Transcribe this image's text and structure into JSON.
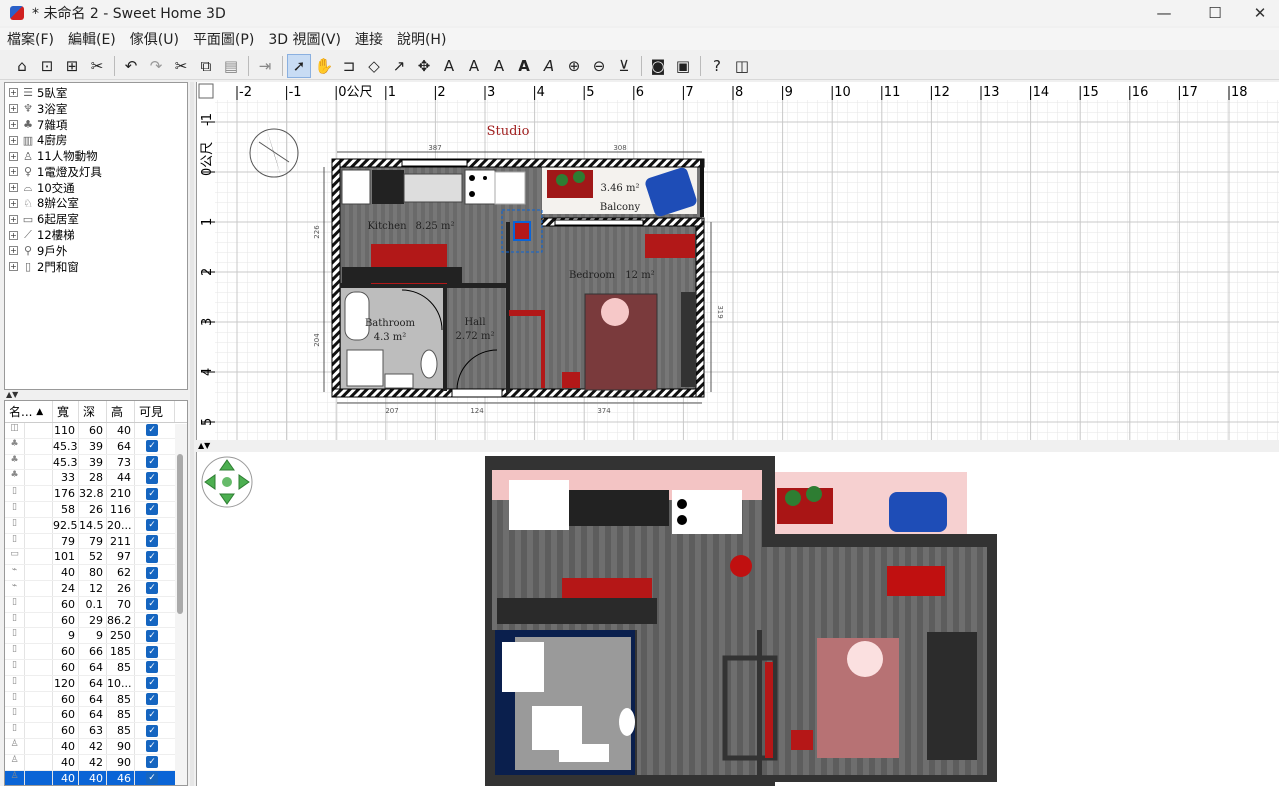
{
  "window": {
    "title": "* 未命名 2 - Sweet Home 3D",
    "min": "—",
    "max": "☐",
    "close": "✕"
  },
  "menu": [
    "檔案(F)",
    "編輯(E)",
    "傢俱(U)",
    "平面圖(P)",
    "3D 視圖(V)",
    "連接",
    "說明(H)"
  ],
  "toolbar_icons": [
    "new-home-icon",
    "new-home-from-example-icon",
    "open-icon",
    "preferences-icon",
    "undo-icon",
    "redo-icon",
    "cut-icon",
    "copy-icon",
    "paste-icon",
    "add-furniture-icon",
    "select-mode-icon",
    "pan-mode-icon",
    "create-walls-icon",
    "create-rooms-icon",
    "create-polylines-icon",
    "create-dimensions-icon",
    "create-labels-icon",
    "increase-text-size-icon",
    "decrease-text-size-icon",
    "bold-text-icon",
    "italic-text-icon",
    "zoom-in-icon",
    "zoom-out-icon",
    "create-photo-icon",
    "create-video-icon",
    "help-icon",
    "about-icon"
  ],
  "catalog": [
    {
      "label": "5臥室",
      "icon": "bed-icon"
    },
    {
      "label": "3浴室",
      "icon": "bathroom-icon"
    },
    {
      "label": "7雜項",
      "icon": "plant-icon"
    },
    {
      "label": "4廚房",
      "icon": "kitchen-icon"
    },
    {
      "label": "11人物動物",
      "icon": "person-icon"
    },
    {
      "label": "1電燈及灯具",
      "icon": "lamp-icon"
    },
    {
      "label": "10交通",
      "icon": "car-icon"
    },
    {
      "label": "8辦公室",
      "icon": "office-icon"
    },
    {
      "label": "6起居室",
      "icon": "sofa-icon"
    },
    {
      "label": "12樓梯",
      "icon": "stairs-icon"
    },
    {
      "label": "9戶外",
      "icon": "outdoor-icon"
    },
    {
      "label": "2門和窗",
      "icon": "door-icon"
    }
  ],
  "furniture_table": {
    "headers": {
      "name": "名...",
      "sort": "▲",
      "width": "寬",
      "depth": "深",
      "height": "高",
      "visible": "可見"
    },
    "rows": [
      [
        "110",
        "60",
        "40"
      ],
      [
        "45.3",
        "39",
        "64"
      ],
      [
        "45.3",
        "39",
        "73"
      ],
      [
        "33",
        "28",
        "44"
      ],
      [
        "176",
        "32.8",
        "210"
      ],
      [
        "58",
        "26",
        "116"
      ],
      [
        "92.5",
        "14.5",
        "20..."
      ],
      [
        "79",
        "79",
        "211"
      ],
      [
        "101",
        "52",
        "97"
      ],
      [
        "40",
        "80",
        "62"
      ],
      [
        "24",
        "12",
        "26"
      ],
      [
        "60",
        "0.1",
        "70"
      ],
      [
        "60",
        "29",
        "86.2"
      ],
      [
        "9",
        "9",
        "250"
      ],
      [
        "60",
        "66",
        "185"
      ],
      [
        "60",
        "64",
        "85"
      ],
      [
        "120",
        "64",
        "10..."
      ],
      [
        "60",
        "64",
        "85"
      ],
      [
        "60",
        "64",
        "85"
      ],
      [
        "60",
        "63",
        "85"
      ],
      [
        "40",
        "42",
        "90"
      ],
      [
        "40",
        "42",
        "90"
      ],
      [
        "40",
        "40",
        "46"
      ]
    ],
    "selected_row": 22
  },
  "plan": {
    "ruler_top": [
      "-2",
      "-1",
      "0公尺",
      "1",
      "2",
      "3",
      "4",
      "5",
      "6",
      "7",
      "8",
      "9",
      "10",
      "11",
      "12",
      "13",
      "14",
      "15",
      "16",
      "17",
      "18"
    ],
    "ruler_left": [
      "-1",
      "0公尺",
      "1",
      "2",
      "3",
      "4",
      "5"
    ],
    "level_title": "Studio",
    "rooms": [
      {
        "name": "Kitchen",
        "area": "8.25 m²"
      },
      {
        "name": "Balcony",
        "area": "3.46 m²"
      },
      {
        "name": "Bedroom",
        "area": "12 m²"
      },
      {
        "name": "Bathroom",
        "area": "4.3 m²"
      },
      {
        "name": "Hall",
        "area": "2.72 m²"
      }
    ],
    "dims": {
      "top_left": "387",
      "top_right": "308",
      "bottom_a": "207",
      "bottom_b": "124",
      "bottom_c": "374",
      "left_a": "226",
      "left_b": "204",
      "right": "319"
    }
  },
  "splitters": {
    "catalog": "▲▼",
    "plan": "▲▼"
  }
}
